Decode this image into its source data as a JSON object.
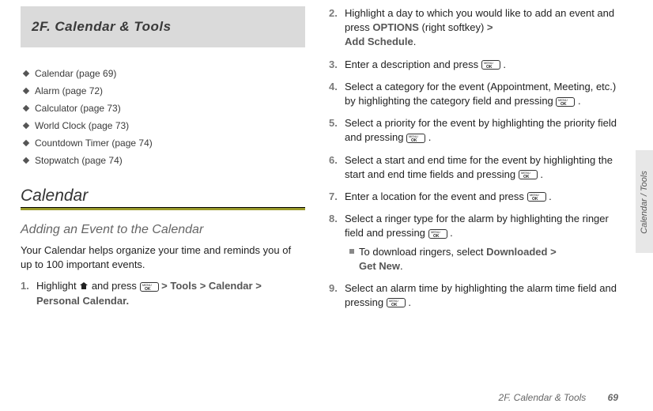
{
  "chapter": {
    "label": "2F.   Calendar & Tools"
  },
  "toc": [
    {
      "label": "Calendar (page 69)"
    },
    {
      "label": "Alarm (page 72)"
    },
    {
      "label": "Calculator (page 73)"
    },
    {
      "label": "World Clock (page 73)"
    },
    {
      "label": "Countdown Timer (page 74)"
    },
    {
      "label": "Stopwatch (page 74)"
    }
  ],
  "section": {
    "title": "Calendar"
  },
  "sub": {
    "title": "Adding an Event to the Calendar"
  },
  "intro": "Your Calendar helps organize your time and reminds you of up to 100 important events.",
  "steps": {
    "s1": {
      "num": "1.",
      "a": "Highlight ",
      "b": " and press ",
      "c": " > ",
      "tools": "Tools",
      "calendar": "Calendar",
      "personal": "Personal Calendar."
    },
    "s2": {
      "num": "2.",
      "a": "Highlight a day to which you would like to add an event and press ",
      "options": "OPTIONS",
      "b": " (right softkey) ",
      "c": "> ",
      "add": "Add Schedule",
      "d": "."
    },
    "s3": {
      "num": "3.",
      "a": "Enter a description and press ",
      "b": "."
    },
    "s4": {
      "num": "4.",
      "a": "Select a category for the event (Appointment, Meeting, etc.) by highlighting the category field and pressing ",
      "b": "."
    },
    "s5": {
      "num": "5.",
      "a": "Select a priority for the event by highlighting the priority field and pressing ",
      "b": "."
    },
    "s6": {
      "num": "6.",
      "a": "Select a start and end time for the event by highlighting the start and end time fields and pressing ",
      "b": "."
    },
    "s7": {
      "num": "7.",
      "a": "Enter a location for the event and press ",
      "b": "."
    },
    "s8": {
      "num": "8.",
      "a": "Select a ringer type for the alarm by highlighting the ringer field and pressing ",
      "b": "."
    },
    "s8sub": {
      "a": "To download ringers, select ",
      "downloaded": "Downloaded",
      "gt": " > ",
      "getnew": "Get New",
      "b": "."
    },
    "s9": {
      "num": "9.",
      "a": "Select an alarm time by highlighting the alarm time field and pressing ",
      "b": "."
    }
  },
  "tab": {
    "label": "Calendar / Tools"
  },
  "footer": {
    "title": "2F. Calendar & Tools",
    "page": "69"
  }
}
